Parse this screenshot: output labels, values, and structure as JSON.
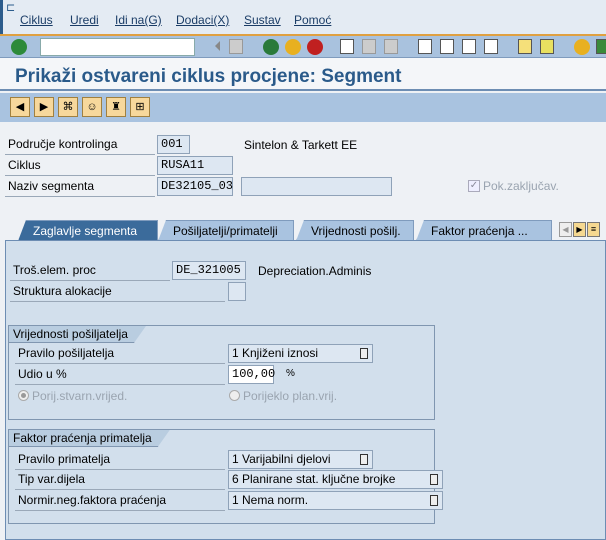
{
  "menu": [
    "Ciklus",
    "Uredi",
    "Idi na(G)",
    "Dodaci(X)",
    "Sustav",
    "Pomoć"
  ],
  "title": "Prikaži ostvareni ciklus procjene: Segment",
  "header": {
    "controlling_area": {
      "label": "Područje kontrolinga",
      "value": "001",
      "desc": "Sintelon & Tarkett EE"
    },
    "cycle": {
      "label": "Ciklus",
      "value": "RUSA11"
    },
    "segment": {
      "label": "Naziv segmenta",
      "value": "DE32105_03",
      "desc": ""
    },
    "lock": {
      "label": "Pok.zaključav.",
      "checked": true
    }
  },
  "tabs": [
    "Zaglavlje segmenta",
    "Pošiljatelji/primatelji",
    "Vrijednosti pošilj.",
    "Faktor praćenja ..."
  ],
  "segment_header": {
    "cost_element": {
      "label": "Troš.elem. proc",
      "value": "DE_321005",
      "desc": "Depreciation.Adminis"
    },
    "alloc_structure": {
      "label": "Struktura alokacije",
      "value": ""
    }
  },
  "sender_values": {
    "title": "Vrijednosti pošiljatelja",
    "rule": {
      "label": "Pravilo pošiljatelja",
      "value": "1 Knjiženi iznosi"
    },
    "share": {
      "label": "Udio u %",
      "value": "100,00",
      "unit": "%"
    },
    "radio_actual": "Porij.stvarn.vrijed.",
    "radio_plan": "Porijeklo plan.vrij."
  },
  "receiver": {
    "title": "Faktor praćenja primatelja",
    "rule": {
      "label": "Pravilo primatelja",
      "value": "1 Varijabilni djelovi"
    },
    "var_type": {
      "label": "Tip var.dijela",
      "value": "6 Planirane stat. ključne brojke"
    },
    "norm": {
      "label": "Normir.neg.faktora praćenja",
      "value": "1 Nema norm."
    }
  }
}
